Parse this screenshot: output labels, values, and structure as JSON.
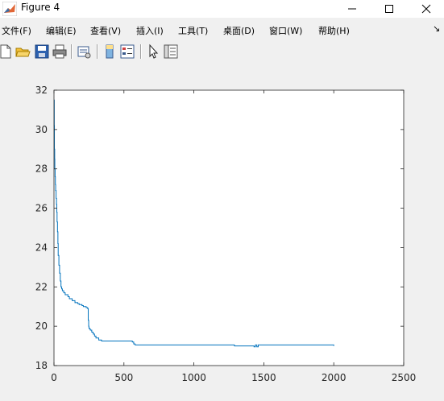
{
  "window": {
    "title": "Figure 4"
  },
  "menu": {
    "items": [
      {
        "label": "文件(F)",
        "name": "menu-file"
      },
      {
        "label": "编辑(E)",
        "name": "menu-edit"
      },
      {
        "label": "查看(V)",
        "name": "menu-view"
      },
      {
        "label": "插入(I)",
        "name": "menu-insert"
      },
      {
        "label": "工具(T)",
        "name": "menu-tools"
      },
      {
        "label": "桌面(D)",
        "name": "menu-desktop"
      },
      {
        "label": "窗口(W)",
        "name": "menu-window"
      },
      {
        "label": "帮助(H)",
        "name": "menu-help"
      }
    ],
    "dock_glyph": "↘"
  },
  "toolbar": {
    "icons": [
      "new-figure-icon",
      "open-file-icon",
      "save-icon",
      "print-icon",
      "link-plot-icon",
      "colorbar-icon",
      "legend-icon",
      "edit-plot-arrow-icon",
      "property-inspector-icon"
    ]
  },
  "colors": {
    "line": "#0072bd",
    "axes": "#262626",
    "plot_bg": "#ffffff",
    "figure_bg": "#f0f0f0"
  },
  "chart_data": {
    "type": "line",
    "title": "",
    "xlabel": "",
    "ylabel": "",
    "xlim": [
      0,
      2500
    ],
    "ylim": [
      18,
      32
    ],
    "xticks": [
      0,
      500,
      1000,
      1500,
      2000,
      2500
    ],
    "yticks": [
      18,
      20,
      22,
      24,
      26,
      28,
      30,
      32
    ],
    "grid": false,
    "series": [
      {
        "x": [
          0,
          2,
          3,
          5,
          6,
          8,
          10,
          12,
          15,
          18,
          20,
          22,
          25,
          28,
          30,
          35,
          40,
          45,
          50,
          55,
          60,
          70,
          80,
          90,
          100,
          110,
          130,
          150,
          170,
          180,
          200,
          210,
          220,
          230,
          240,
          245,
          248,
          250,
          255,
          260,
          270,
          280,
          290,
          300,
          320,
          340,
          360,
          400,
          450,
          500,
          550,
          560,
          570,
          580,
          600,
          800,
          1000,
          1200,
          1280,
          1290,
          1400,
          1430,
          1440,
          1450,
          1460,
          1500,
          1700,
          1900,
          2000
        ],
        "y": [
          31.5,
          30.2,
          29.0,
          28.5,
          28.0,
          27.6,
          27.2,
          26.9,
          26.5,
          26.2,
          25.8,
          25.3,
          24.8,
          24.2,
          23.6,
          23.1,
          22.7,
          22.3,
          22.0,
          21.9,
          21.8,
          21.7,
          21.6,
          21.6,
          21.5,
          21.4,
          21.3,
          21.2,
          21.15,
          21.1,
          21.05,
          21.0,
          21.0,
          20.95,
          20.9,
          20.3,
          20.0,
          19.9,
          19.85,
          19.8,
          19.7,
          19.6,
          19.5,
          19.4,
          19.3,
          19.25,
          19.25,
          19.25,
          19.25,
          19.25,
          19.25,
          19.2,
          19.1,
          19.05,
          19.05,
          19.05,
          19.05,
          19.05,
          19.05,
          19.0,
          19.0,
          18.95,
          19.05,
          18.95,
          19.05,
          19.05,
          19.05,
          19.05,
          19.0
        ]
      }
    ]
  }
}
